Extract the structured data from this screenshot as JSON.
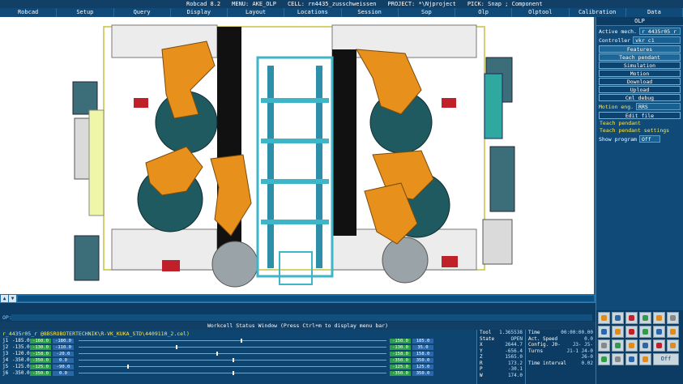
{
  "titlebar": {
    "app": "Robcad 8.2",
    "menu": "MENU: AKE_OLP",
    "cell": "CELL: rn4435_zusschweissen",
    "project": "PROJECT: *\\Njproject",
    "pick": "PICK: Snap ; Component"
  },
  "menubar": [
    "Robcad",
    "Setup",
    "Query",
    "Display",
    "Layout",
    "Locations",
    "Session",
    "Sop",
    "Olp",
    "Olptool",
    "Calibration",
    "Data"
  ],
  "olp_panel": {
    "title": "OLP",
    "active_mech_label": "Active mech.",
    "active_mech_value": "r_4435r05_r",
    "controller_label": "Controller",
    "controller_value": "vkr_c1",
    "buttons": [
      "Features",
      "Teach pendant",
      "Simulation",
      "Motion",
      "Download",
      "Upload",
      "Cml debug"
    ],
    "motion_eng_label": "Motion eng.",
    "motion_eng_value": "RRS",
    "edit_file": "Edit file",
    "items": [
      "Teach pendant",
      "Teach pendant settings"
    ],
    "show_program_label": "Show program",
    "show_program_value": "Off"
  },
  "message": {
    "prompt": "OP:"
  },
  "workcell": {
    "title": "Workcell Status Window   (Press Ctrl+m to display menu bar)",
    "path": "r_4435r05_r @8BSROBOTERTECHNIK\\R-VK_KUKA_STD\\4409110_2.cel)",
    "joints": [
      {
        "name": "j1",
        "lo": "-185.0",
        "low": "-160.0",
        "cur": "-180.0",
        "high": "-150.0",
        "max": "185.0"
      },
      {
        "name": "j2",
        "lo": "-135.0",
        "low": "-130.0",
        "cur": "-110.0",
        "high": "-130.0",
        "max": "35.0"
      },
      {
        "name": "j3",
        "lo": "-120.0",
        "low": "-158.0",
        "cur": "-20.0",
        "high": "-158.0",
        "max": "158.0"
      },
      {
        "name": "j4",
        "lo": "-350.0",
        "low": "-350.0",
        "cur": "0.0",
        "high": "-350.0",
        "max": "350.0"
      },
      {
        "name": "j5",
        "lo": "-125.0",
        "low": "-125.0",
        "cur": "-90.0",
        "high": "-125.0",
        "max": "125.0"
      },
      {
        "name": "j6",
        "lo": "-350.0",
        "low": "-350.0",
        "cur": "0.0",
        "high": "-350.0",
        "max": "350.0"
      }
    ],
    "status": [
      {
        "k": "Tool",
        "v": "1.365538"
      },
      {
        "k": "State",
        "v": "OPEN"
      },
      {
        "k": "X",
        "v": "2644.7"
      },
      {
        "k": "Y",
        "v": "-656.4"
      },
      {
        "k": "Z",
        "v": "1565.0"
      },
      {
        "k": "R",
        "v": "173.2"
      },
      {
        "k": "P",
        "v": "-30.1"
      },
      {
        "k": "W",
        "v": "174.0"
      }
    ],
    "status2": [
      {
        "k": "Time",
        "v": "00:00:00.00"
      },
      {
        "k": "Act. Speed",
        "v": "0.0"
      },
      {
        "k": "Config. J0-",
        "v": "J3- J5-"
      },
      {
        "k": "Turns",
        "v": "J1-1 J4-0"
      },
      {
        "k": "",
        "v": "J6-0"
      },
      {
        "k": "Time interval",
        "v": "0.02"
      },
      {
        "k": "",
        "v": ""
      },
      {
        "k": "",
        "v": ""
      }
    ]
  },
  "tools": {
    "off_label": "Off"
  },
  "colors": {
    "panel_bg": "#0f4a78",
    "robot_orange": "#e8901c",
    "fixture_cyan": "#3fb6c8",
    "accent_yellow": "#ffe94d"
  }
}
